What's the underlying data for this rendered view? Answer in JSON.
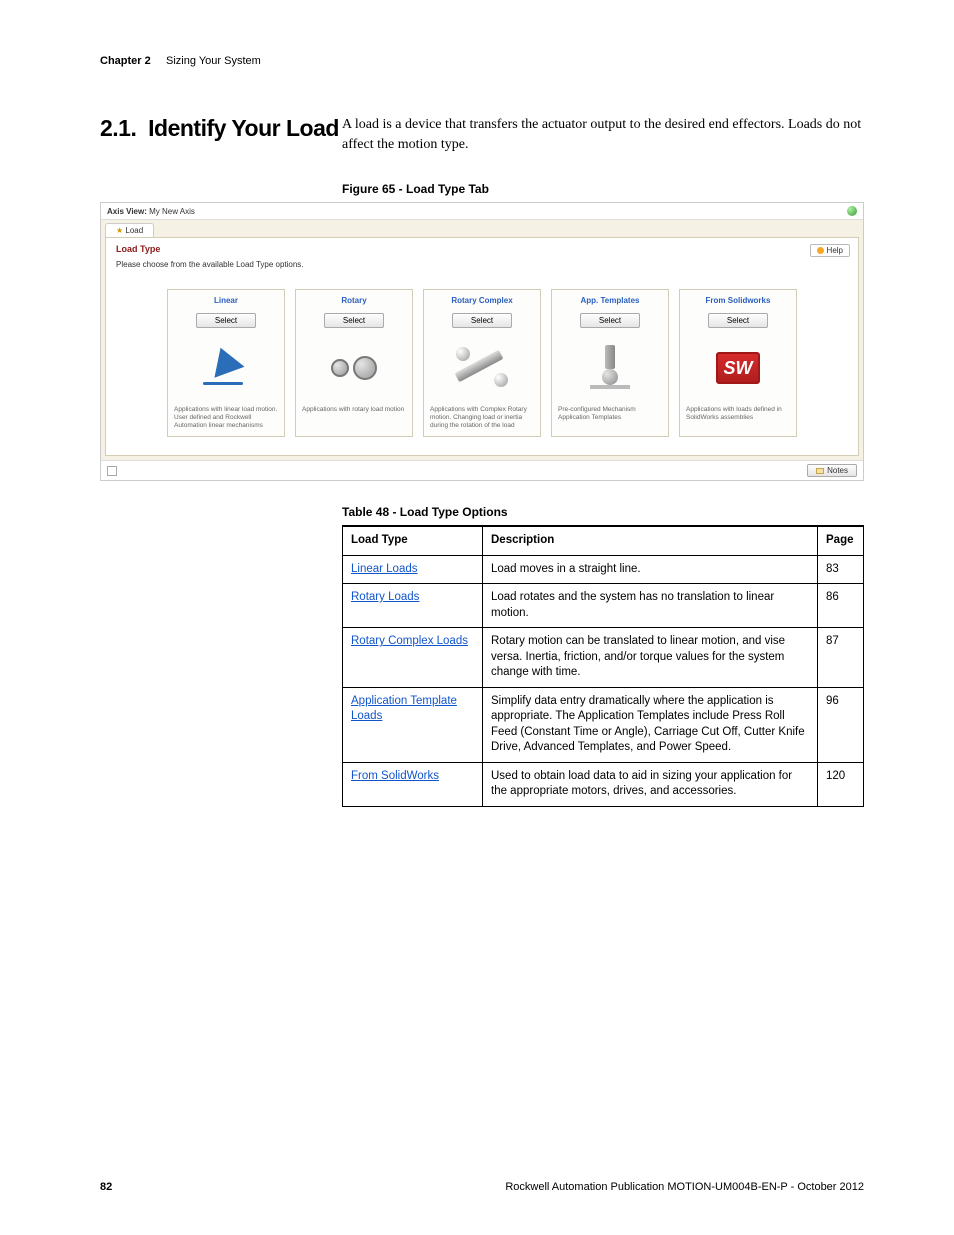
{
  "header": {
    "chapter_label": "Chapter 2",
    "chapter_title": "Sizing Your System"
  },
  "section": {
    "number": "2.1.",
    "title": "Identify Your Load",
    "intro": "A load is a device that transfers the actuator output to the desired end effectors. Loads do not affect the motion type."
  },
  "figure_caption": "Figure 65 - Load Type Tab",
  "screenshot": {
    "axis_view_label": "Axis View:",
    "axis_view_value": "My New Axis",
    "tab_label": "Load",
    "panel_title": "Load Type",
    "help_label": "Help",
    "instruction": "Please choose from the available Load Type options.",
    "select_label": "Select",
    "notes_label": "Notes",
    "cards": [
      {
        "title": "Linear",
        "desc": "Applications with linear load motion. User defined and Rockwell Automation linear mechanisms"
      },
      {
        "title": "Rotary",
        "desc": "Applications with rotary load motion"
      },
      {
        "title": "Rotary Complex",
        "desc": "Applications with Complex Rotary motion. Changing load or inertia during the rotation of the load"
      },
      {
        "title": "App. Templates",
        "desc": "Pre-configured Mechanism Application Templates"
      },
      {
        "title": "From Solidworks",
        "desc": "Applications with loads defined in SolidWorks assemblies"
      }
    ]
  },
  "table_caption": "Table 48 - Load Type Options",
  "table": {
    "headers": {
      "c1": "Load Type",
      "c2": "Description",
      "c3": "Page"
    },
    "rows": [
      {
        "type": "Linear Loads",
        "desc": "Load moves in a straight line.",
        "page": "83"
      },
      {
        "type": "Rotary Loads",
        "desc": "Load rotates and the system has no translation to linear motion.",
        "page": "86"
      },
      {
        "type": "Rotary Complex Loads",
        "desc": "Rotary motion can be translated to linear motion, and vise versa. Inertia, friction, and/or torque values for the system change with time.",
        "page": "87"
      },
      {
        "type": "Application Template Loads",
        "desc": "Simplify data entry dramatically where the application is appropriate. The Application Templates include Press Roll Feed (Constant Time or Angle), Carriage Cut Off, Cutter Knife Drive, Advanced Templates, and Power Speed.",
        "page": "96"
      },
      {
        "type": "From SolidWorks",
        "desc": "Used to obtain load data to aid in sizing your application for the appropriate motors, drives, and accessories.",
        "page": "120"
      }
    ]
  },
  "footer": {
    "page": "82",
    "pub": "Rockwell Automation Publication MOTION-UM004B-EN-P - October 2012"
  }
}
